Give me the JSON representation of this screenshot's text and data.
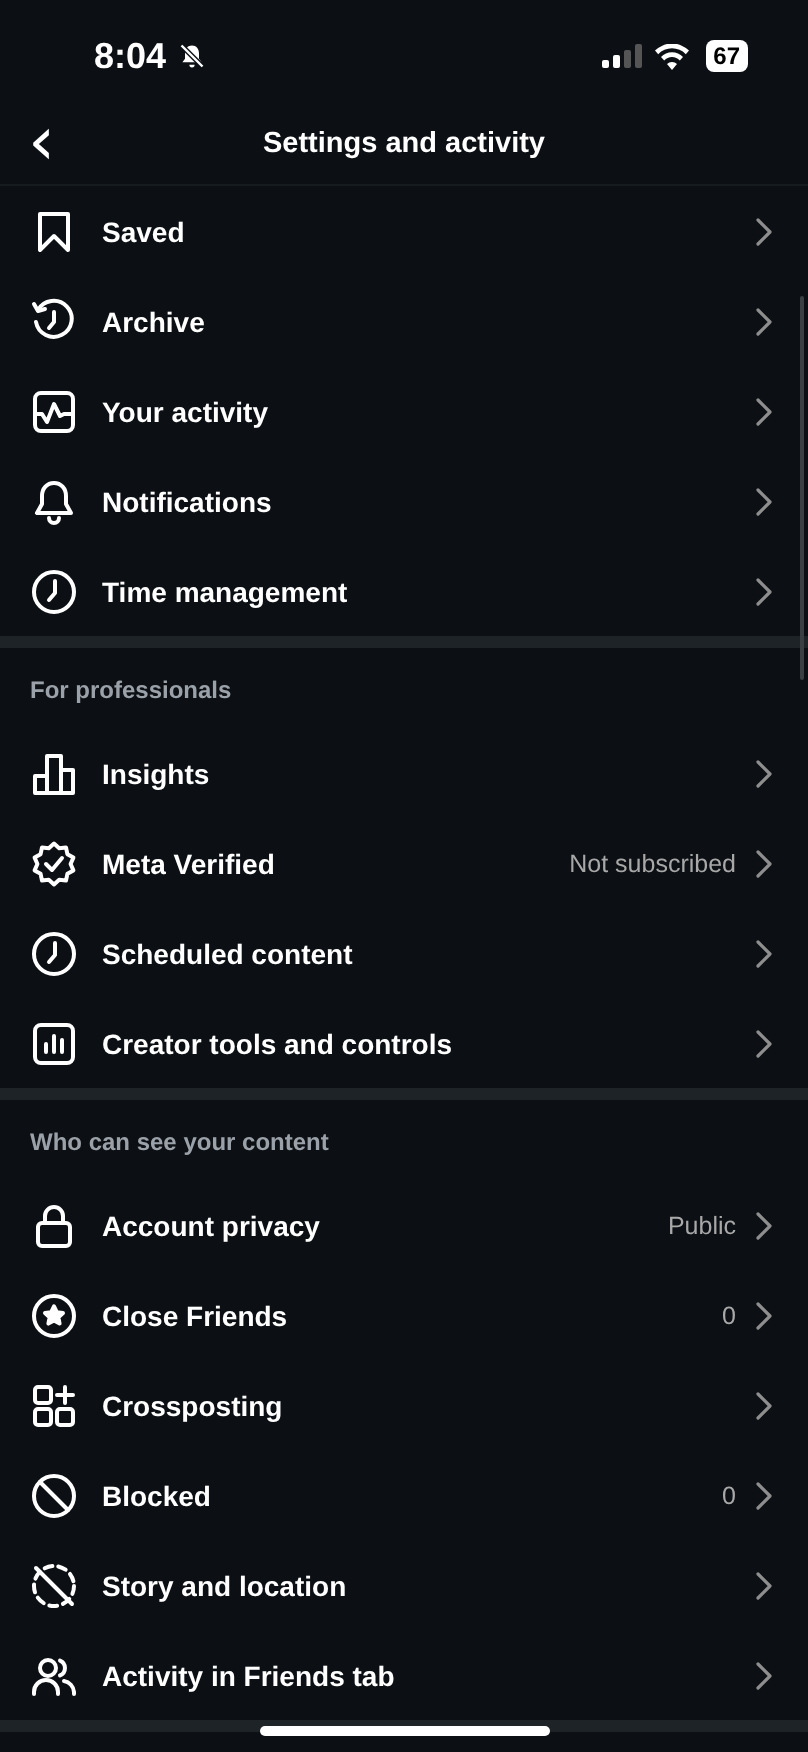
{
  "status_bar": {
    "time": "8:04",
    "battery": "67"
  },
  "header": {
    "back": "‹",
    "title": "Settings and activity"
  },
  "sections": [
    {
      "items": [
        {
          "label": "Saved"
        },
        {
          "label": "Archive"
        },
        {
          "label": "Your activity"
        },
        {
          "label": "Notifications"
        },
        {
          "label": "Time management"
        }
      ]
    },
    {
      "title": "For professionals",
      "items": [
        {
          "label": "Insights"
        },
        {
          "label": "Meta Verified",
          "value": "Not subscribed"
        },
        {
          "label": "Scheduled content"
        },
        {
          "label": "Creator tools and controls"
        }
      ]
    },
    {
      "title": "Who can see your content",
      "items": [
        {
          "label": "Account privacy",
          "value": "Public"
        },
        {
          "label": "Close Friends",
          "value": "0"
        },
        {
          "label": "Crossposting"
        },
        {
          "label": "Blocked",
          "value": "0"
        },
        {
          "label": "Story and location"
        },
        {
          "label": "Activity in Friends tab"
        }
      ]
    }
  ]
}
